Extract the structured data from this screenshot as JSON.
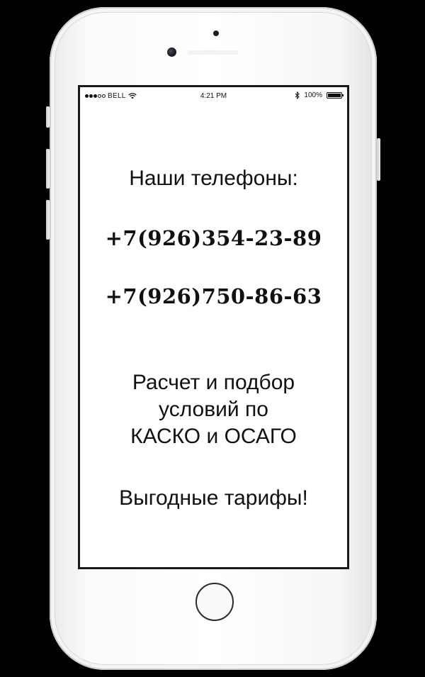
{
  "status_bar": {
    "carrier": "BELL",
    "time": "4:21 PM",
    "battery": "100%",
    "battery_level": 1.0,
    "signal_bars_filled": 3,
    "signal_bars_total": 5,
    "icons": [
      "wifi-icon",
      "bluetooth-icon",
      "battery-icon"
    ]
  },
  "screen": {
    "heading": "Наши телефоны:",
    "phones": [
      "+7(926)354-23-89",
      "+7(926)750-86-63"
    ],
    "promo_lines": [
      "Расчет и подбор",
      "условий по",
      "КАСКО и ОСАГО"
    ],
    "tagline": "Выгодные тарифы!"
  },
  "colors": {
    "background": "#000000",
    "phone_body": "#ffffff",
    "screen": "#ffffff",
    "text": "#111111"
  }
}
